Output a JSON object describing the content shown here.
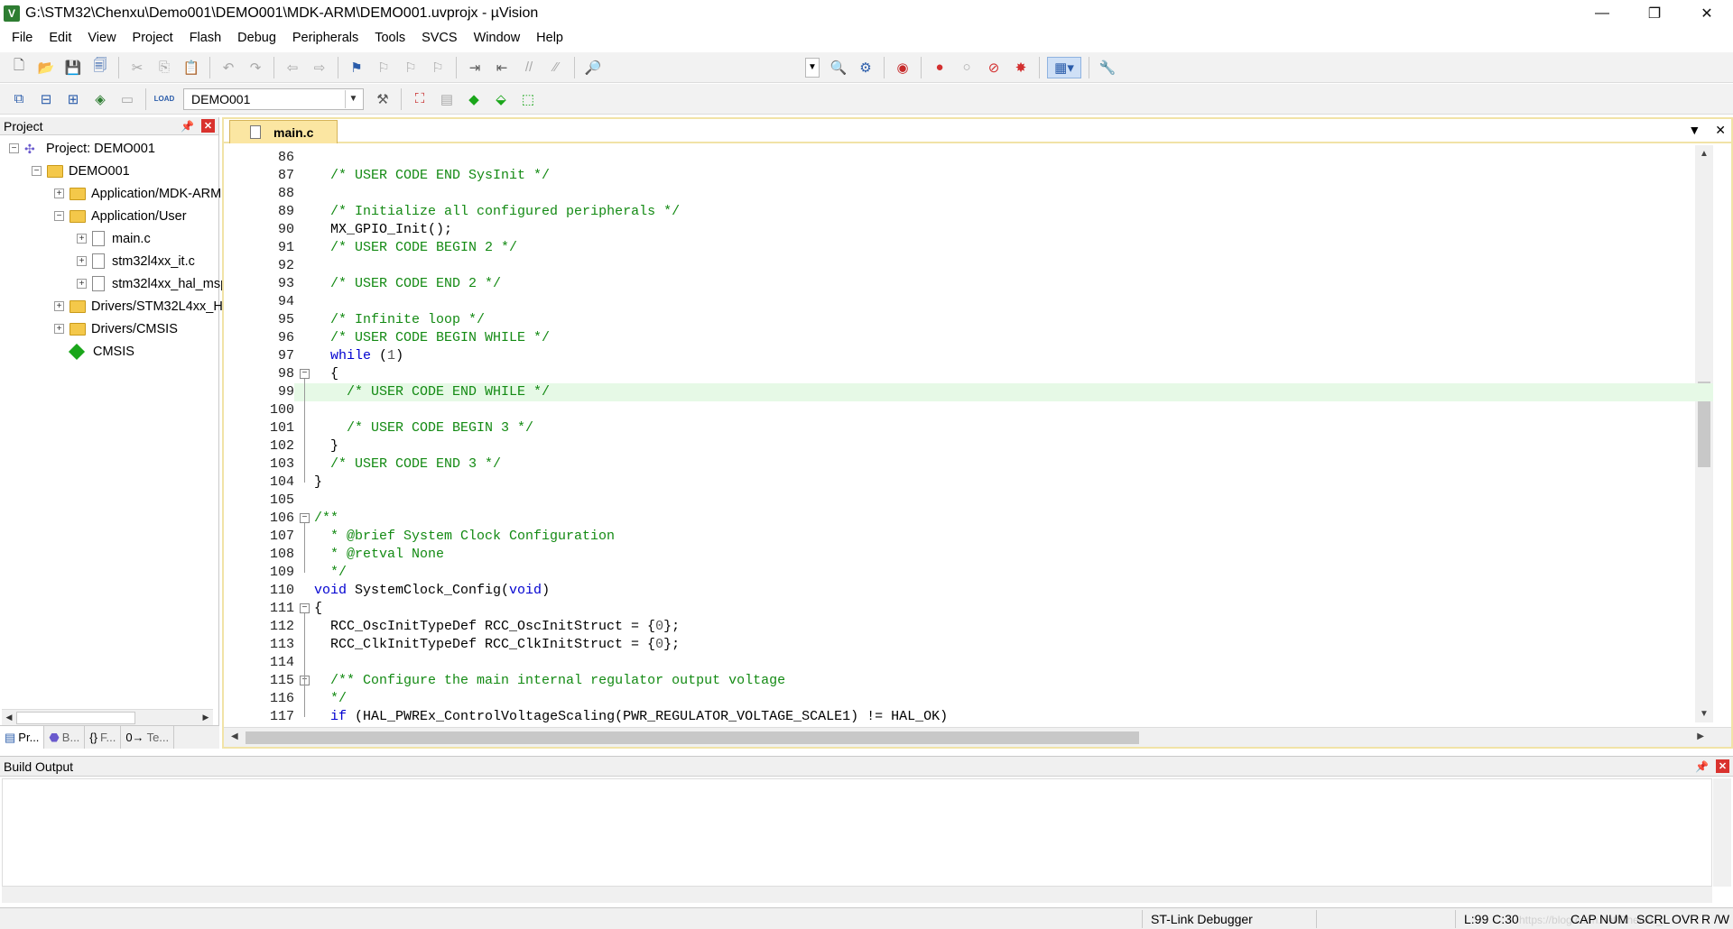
{
  "window": {
    "title": "G:\\STM32\\Chenxu\\Demo001\\DEMO001\\MDK-ARM\\DEMO001.uvprojx - µVision",
    "app_icon": "V",
    "minimize": "—",
    "restore": "❐",
    "close": "✕"
  },
  "menu": [
    "File",
    "Edit",
    "View",
    "Project",
    "Flash",
    "Debug",
    "Peripherals",
    "Tools",
    "SVCS",
    "Window",
    "Help"
  ],
  "toolbar2": {
    "load_label": "LOAD",
    "target": "DEMO001"
  },
  "project_panel": {
    "title": "Project",
    "tree": [
      {
        "label": "Project: DEMO001",
        "level": 0,
        "toggle": "−",
        "icon": "project-icon"
      },
      {
        "label": "DEMO001",
        "level": 1,
        "toggle": "−",
        "icon": "target-folder-icon"
      },
      {
        "label": "Application/MDK-ARM",
        "level": 2,
        "toggle": "+",
        "icon": "folder-icon"
      },
      {
        "label": "Application/User",
        "level": 2,
        "toggle": "−",
        "icon": "folder-icon"
      },
      {
        "label": "main.c",
        "level": 3,
        "toggle": "+",
        "icon": "file-icon"
      },
      {
        "label": "stm32l4xx_it.c",
        "level": 3,
        "toggle": "+",
        "icon": "file-icon"
      },
      {
        "label": "stm32l4xx_hal_msp.c",
        "level": 3,
        "toggle": "+",
        "icon": "file-icon"
      },
      {
        "label": "Drivers/STM32L4xx_HAL_Driver",
        "level": 2,
        "toggle": "+",
        "icon": "folder-icon"
      },
      {
        "label": "Drivers/CMSIS",
        "level": 2,
        "toggle": "+",
        "icon": "folder-icon"
      },
      {
        "label": "CMSIS",
        "level": 2,
        "toggle": "",
        "icon": "cmsis-icon"
      }
    ],
    "bottom_tabs": [
      {
        "label": "Pr...",
        "icon": "project-tab-icon"
      },
      {
        "label": "B...",
        "icon": "books-tab-icon"
      },
      {
        "label": "F...",
        "icon": "functions-tab-icon"
      },
      {
        "label": "Te...",
        "icon": "templates-tab-icon"
      }
    ]
  },
  "editor": {
    "tab_label": "main.c",
    "current_line": 99,
    "lines": [
      {
        "n": "86",
        "parts": []
      },
      {
        "n": "87",
        "parts": [
          {
            "t": "  ",
            "c": ""
          },
          {
            "t": "/* USER CODE END SysInit */",
            "c": "cm"
          }
        ]
      },
      {
        "n": "88",
        "parts": []
      },
      {
        "n": "89",
        "parts": [
          {
            "t": "  ",
            "c": ""
          },
          {
            "t": "/* Initialize all configured peripherals */",
            "c": "cm"
          }
        ]
      },
      {
        "n": "90",
        "parts": [
          {
            "t": "  MX_GPIO_Init();",
            "c": ""
          }
        ]
      },
      {
        "n": "91",
        "parts": [
          {
            "t": "  ",
            "c": ""
          },
          {
            "t": "/* USER CODE BEGIN 2 */",
            "c": "cm"
          }
        ]
      },
      {
        "n": "92",
        "parts": []
      },
      {
        "n": "93",
        "parts": [
          {
            "t": "  ",
            "c": ""
          },
          {
            "t": "/* USER CODE END 2 */",
            "c": "cm"
          }
        ]
      },
      {
        "n": "94",
        "parts": []
      },
      {
        "n": "95",
        "parts": [
          {
            "t": "  ",
            "c": ""
          },
          {
            "t": "/* Infinite loop */",
            "c": "cm"
          }
        ]
      },
      {
        "n": "96",
        "parts": [
          {
            "t": "  ",
            "c": ""
          },
          {
            "t": "/* USER CODE BEGIN WHILE */",
            "c": "cm"
          }
        ]
      },
      {
        "n": "97",
        "parts": [
          {
            "t": "  ",
            "c": ""
          },
          {
            "t": "while",
            "c": "kw"
          },
          {
            "t": " (",
            "c": ""
          },
          {
            "t": "1",
            "c": "num"
          },
          {
            "t": ")",
            "c": ""
          }
        ]
      },
      {
        "n": "98",
        "fold": "−",
        "parts": [
          {
            "t": "  {",
            "c": ""
          }
        ]
      },
      {
        "n": "99",
        "parts": [
          {
            "t": "    ",
            "c": ""
          },
          {
            "t": "/* USER CODE END WHILE */",
            "c": "cm"
          }
        ]
      },
      {
        "n": "100",
        "parts": []
      },
      {
        "n": "101",
        "parts": [
          {
            "t": "    ",
            "c": ""
          },
          {
            "t": "/* USER CODE BEGIN 3 */",
            "c": "cm"
          }
        ]
      },
      {
        "n": "102",
        "parts": [
          {
            "t": "  }",
            "c": ""
          }
        ]
      },
      {
        "n": "103",
        "parts": [
          {
            "t": "  ",
            "c": ""
          },
          {
            "t": "/* USER CODE END 3 */",
            "c": "cm"
          }
        ]
      },
      {
        "n": "104",
        "parts": [
          {
            "t": "}",
            "c": ""
          }
        ]
      },
      {
        "n": "105",
        "parts": []
      },
      {
        "n": "106",
        "fold": "−",
        "parts": [
          {
            "t": "/**",
            "c": "cm"
          }
        ]
      },
      {
        "n": "107",
        "parts": [
          {
            "t": "  * @brief System Clock Configuration",
            "c": "cm"
          }
        ]
      },
      {
        "n": "108",
        "parts": [
          {
            "t": "  * @retval None",
            "c": "cm"
          }
        ]
      },
      {
        "n": "109",
        "parts": [
          {
            "t": "  */",
            "c": "cm"
          }
        ]
      },
      {
        "n": "110",
        "parts": [
          {
            "t": "void",
            "c": "kw"
          },
          {
            "t": " SystemClock_Config(",
            "c": ""
          },
          {
            "t": "void",
            "c": "kw"
          },
          {
            "t": ")",
            "c": ""
          }
        ]
      },
      {
        "n": "111",
        "fold": "−",
        "parts": [
          {
            "t": "{",
            "c": ""
          }
        ]
      },
      {
        "n": "112",
        "parts": [
          {
            "t": "  RCC_OscInitTypeDef RCC_OscInitStruct = {",
            "c": ""
          },
          {
            "t": "0",
            "c": "num"
          },
          {
            "t": "};",
            "c": ""
          }
        ]
      },
      {
        "n": "113",
        "parts": [
          {
            "t": "  RCC_ClkInitTypeDef RCC_ClkInitStruct = {",
            "c": ""
          },
          {
            "t": "0",
            "c": "num"
          },
          {
            "t": "};",
            "c": ""
          }
        ]
      },
      {
        "n": "114",
        "parts": []
      },
      {
        "n": "115",
        "fold": "−",
        "parts": [
          {
            "t": "  ",
            "c": ""
          },
          {
            "t": "/** Configure the main internal regulator output voltage",
            "c": "cm"
          }
        ]
      },
      {
        "n": "116",
        "parts": [
          {
            "t": "  */",
            "c": "cm"
          }
        ]
      },
      {
        "n": "117",
        "parts": [
          {
            "t": "  ",
            "c": ""
          },
          {
            "t": "if",
            "c": "kw"
          },
          {
            "t": " (HAL_PWREx_ControlVoltageScaling(PWR_REGULATOR_VOLTAGE_SCALE1) != HAL_OK)",
            "c": ""
          }
        ]
      }
    ]
  },
  "build_output": {
    "title": "Build Output"
  },
  "statusbar": {
    "debugger": "ST-Link Debugger",
    "position": "L:99 C:30",
    "watermark": "https://blog.csdn.net/Chenxu_",
    "cap": "CAP",
    "num": "NUM",
    "scrl": "SCRL",
    "ovr": "OVR",
    "rw": "R /W"
  }
}
